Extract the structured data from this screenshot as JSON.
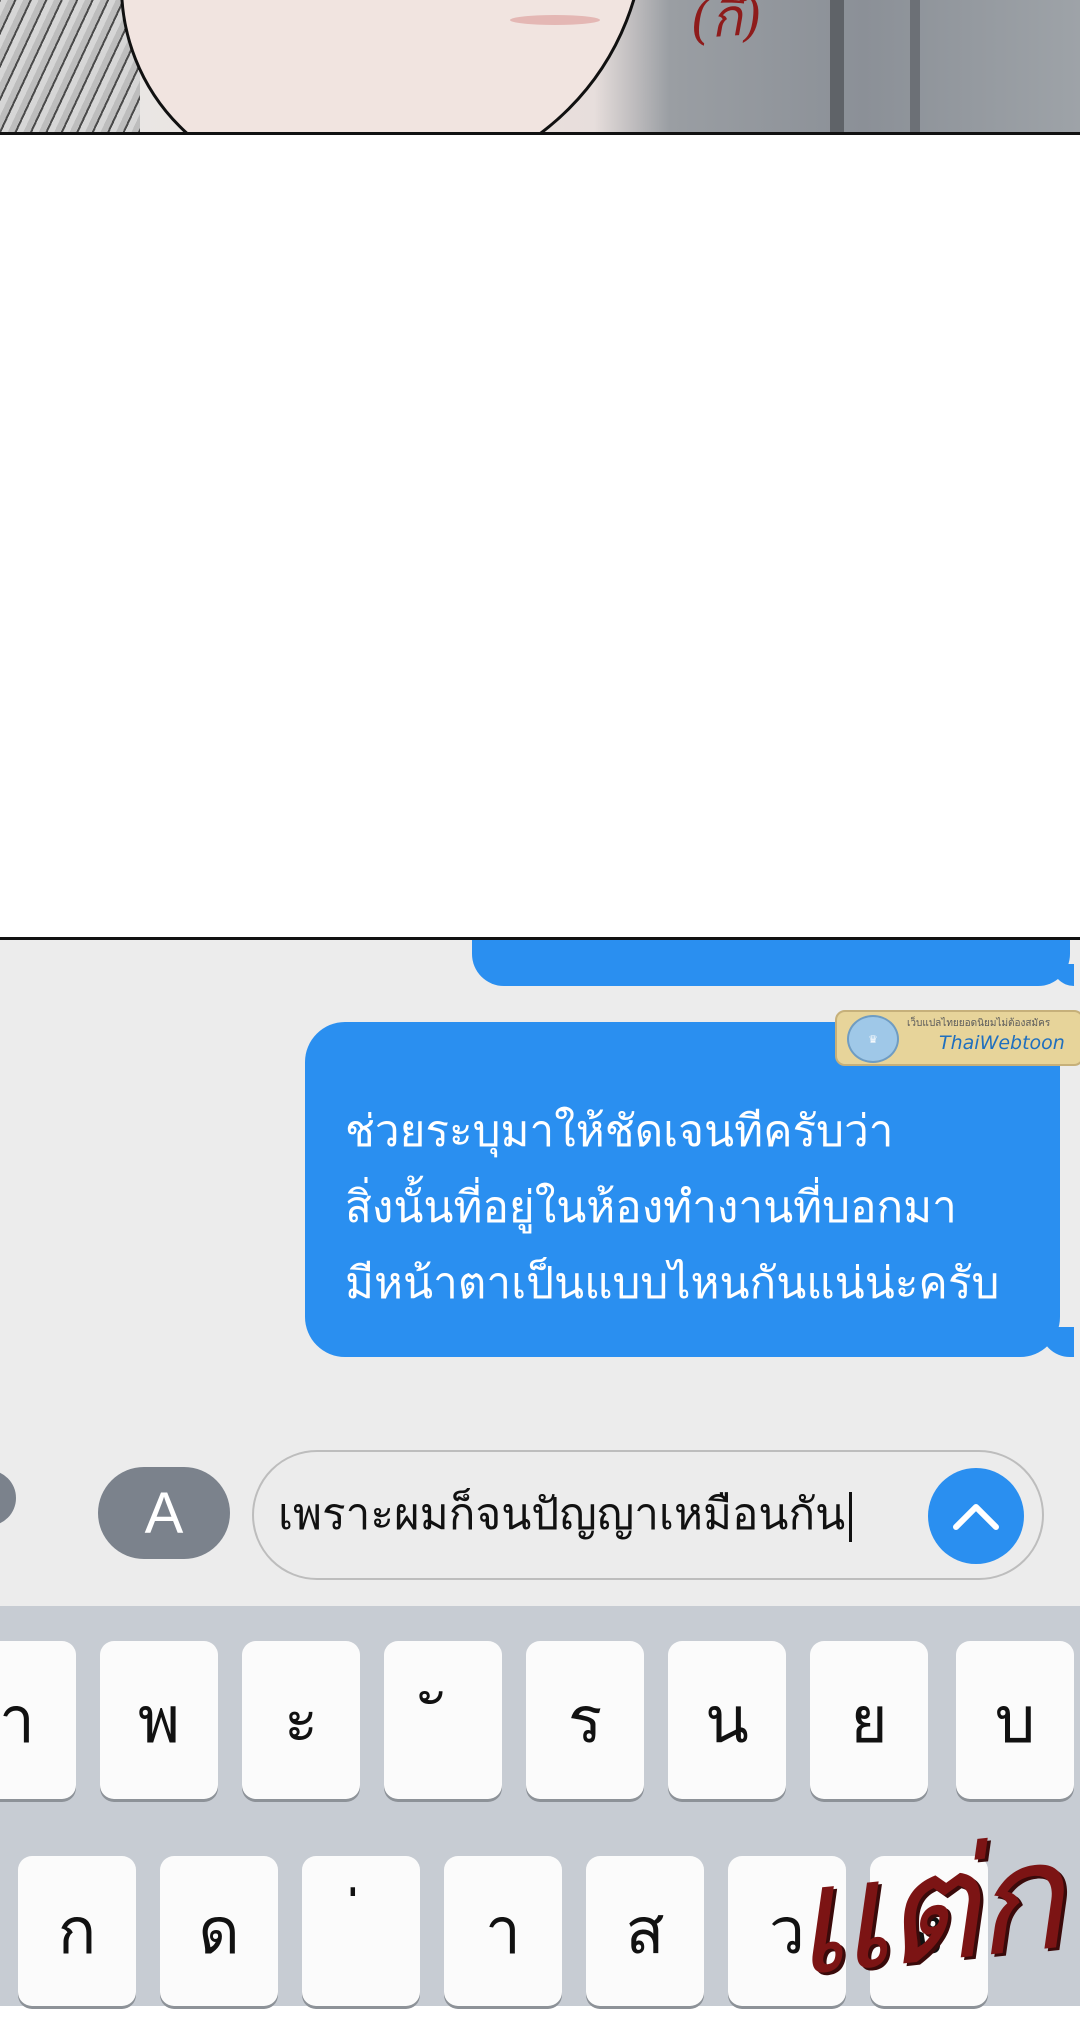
{
  "top_panel": {
    "sfx": "(กึ)"
  },
  "chat": {
    "message_lines": [
      "ช่วยระบุมาให้ชัดเจนทีครับว่า",
      "สิ่งนั้นที่อยู่ในห้องทำงานที่บอกมา",
      "มีหน้าตาเป็นแบบไหนกันแน่น่ะครับ"
    ],
    "watermark": {
      "tagline": "เว็บแปลไทยยอดนิยมไม่ต้องสมัคร",
      "name": "ThaiWebtoon"
    },
    "app_button_label": "A",
    "input_value": "เพราะผมก็จนปัญญาเหมือนกัน",
    "send_icon": "chevron-up-icon"
  },
  "keyboard": {
    "row1": [
      "ำ",
      "พ",
      "ะ",
      "ั",
      "ร",
      "น",
      "ย",
      "บ"
    ],
    "row2": [
      "ก",
      "ด",
      "่",
      "า",
      "ส",
      "ว",
      "ง"
    ]
  },
  "sfx_bottom": "แต่ก",
  "colors": {
    "bubble": "#2a8ff0",
    "keyboard": "#c7ccd3",
    "sfx": "#7c1414"
  }
}
